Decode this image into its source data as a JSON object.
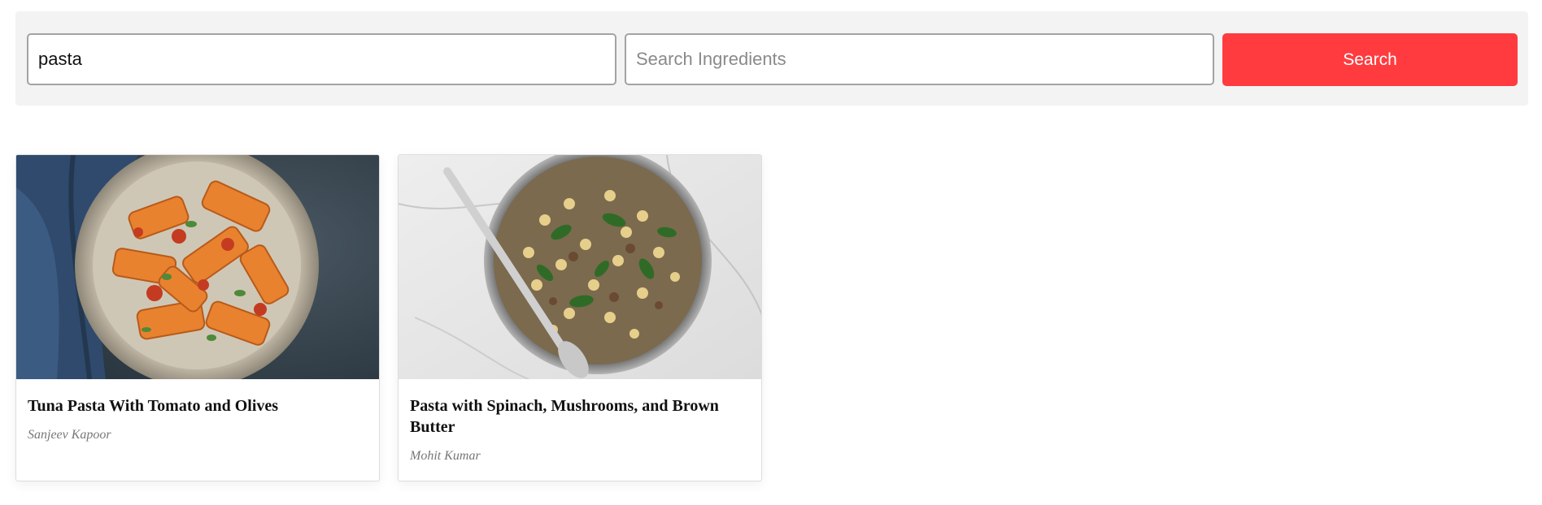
{
  "search": {
    "name_value": "pasta",
    "name_placeholder": "",
    "ingredients_value": "",
    "ingredients_placeholder": "Search Ingredients",
    "button_label": "Search",
    "button_color": "#ff3b3f",
    "bar_color": "#f3f3f3"
  },
  "recipes": [
    {
      "title": "Tuna Pasta With Tomato and Olives",
      "author": "Sanjeev Kapoor",
      "image_icon": "rigatoni-tomato-dish-image"
    },
    {
      "title": "Pasta with Spinach, Mushrooms, and Brown Butter",
      "author": "Mohit Kumar",
      "image_icon": "spinach-mushroom-pasta-pan-image"
    }
  ]
}
